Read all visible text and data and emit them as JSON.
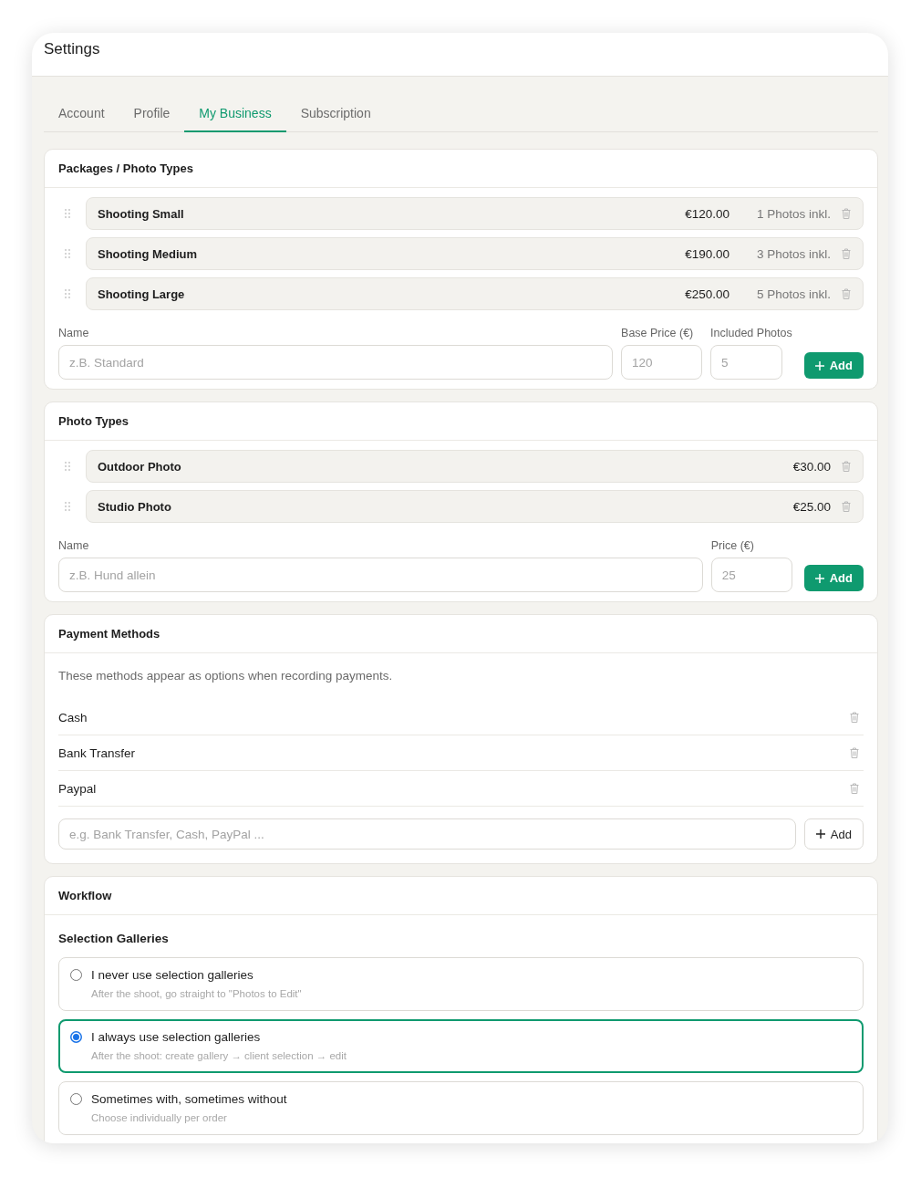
{
  "window": {
    "title": "Settings"
  },
  "tabs": [
    {
      "label": "Account",
      "selected": false
    },
    {
      "label": "Profile",
      "selected": false
    },
    {
      "label": "My Business",
      "selected": true
    },
    {
      "label": "Subscription",
      "selected": false
    }
  ],
  "packages": {
    "title": "Packages / Photo Types",
    "items": [
      {
        "name": "Shooting Small",
        "price": "€120.00",
        "included": "1 Photos inkl."
      },
      {
        "name": "Shooting Medium",
        "price": "€190.00",
        "included": "3 Photos inkl."
      },
      {
        "name": "Shooting Large",
        "price": "€250.00",
        "included": "5 Photos inkl."
      }
    ],
    "form": {
      "fields": [
        {
          "label": "Name",
          "placeholder": "z.B. Standard"
        },
        {
          "label": "Base Price (€)",
          "placeholder": "120"
        },
        {
          "label": "Included Photos",
          "placeholder": "5"
        }
      ],
      "button": "Add"
    }
  },
  "photo_types": {
    "title": "Photo Types",
    "items": [
      {
        "name": "Outdoor Photo",
        "price": "€30.00"
      },
      {
        "name": "Studio Photo",
        "price": "€25.00"
      }
    ],
    "form": {
      "fields": [
        {
          "label": "Name",
          "placeholder": "z.B. Hund allein"
        },
        {
          "label": "Price (€)",
          "placeholder": "25"
        }
      ],
      "button": "Add"
    }
  },
  "payment_methods": {
    "title": "Payment Methods",
    "description": "These methods appear as options when recording payments.",
    "items": [
      {
        "name": "Cash"
      },
      {
        "name": "Bank Transfer"
      },
      {
        "name": "Paypal"
      }
    ],
    "input": {
      "placeholder": "e.g. Bank Transfer, Cash, PayPal ..."
    },
    "button": "Add"
  },
  "workflow": {
    "title": "Workflow",
    "section": "Selection Galleries",
    "options": [
      {
        "title": "I never use selection galleries",
        "description": "After the shoot, go straight to \"Photos to Edit\"",
        "selected": false
      },
      {
        "title": "I always use selection galleries",
        "description": "After the shoot: create gallery → client selection → edit",
        "selected": true
      },
      {
        "title": "Sometimes with, sometimes without",
        "description": "Choose individually per order",
        "selected": false
      }
    ]
  }
}
